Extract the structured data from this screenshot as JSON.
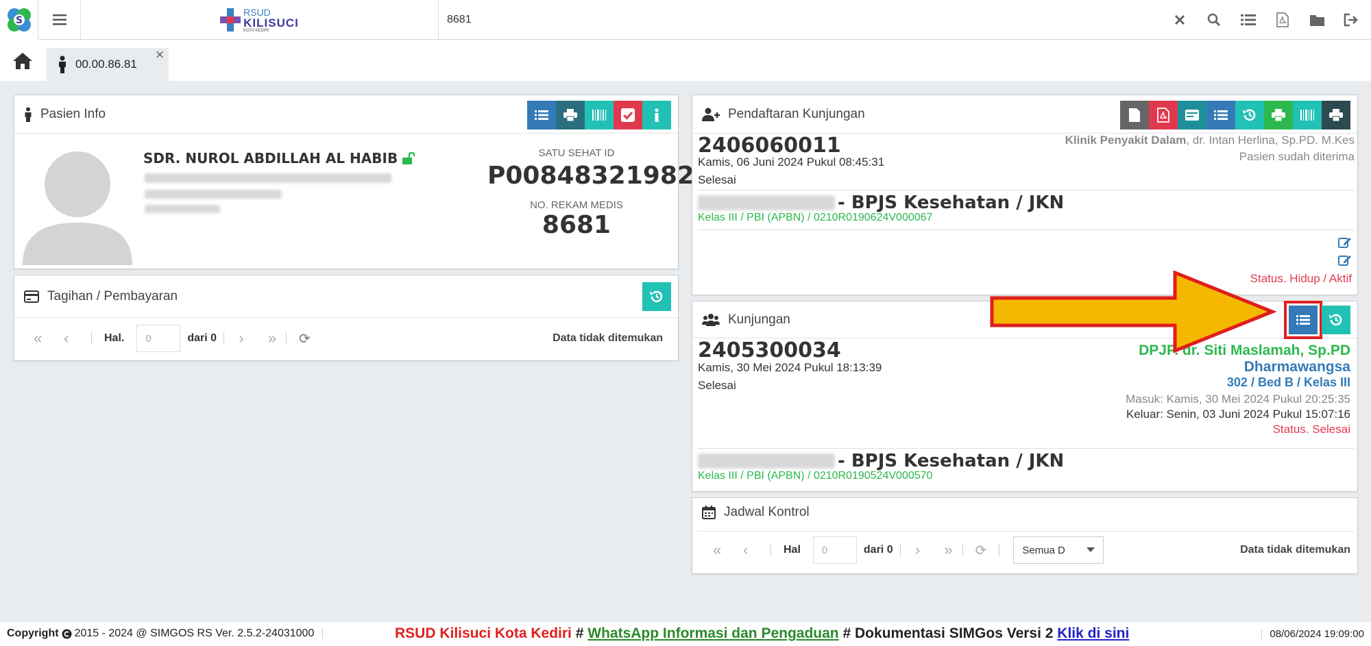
{
  "topbar": {
    "brand_line1": "RSUD",
    "brand_line2": "KILISUCI",
    "brand_line3": "KOTA KEDIRI",
    "search_value": "8681",
    "icons": [
      "close-icon",
      "search-icon",
      "list-icon",
      "pdf-file-icon",
      "folder-icon",
      "logout-icon"
    ]
  },
  "tabs": {
    "home_icon": "home-icon",
    "patient_tab": "00.00.86.81",
    "close": "×"
  },
  "pasien": {
    "title": "Pasien Info",
    "name": "SDR. NUROL ABDILLAH AL HABIB",
    "satu_sehat_label": "SATU SEHAT ID",
    "satu_sehat_id": "P00848321982",
    "rm_label": "NO. REKAM MEDIS",
    "rm_value": "8681"
  },
  "tagihan": {
    "title": "Tagihan / Pembayaran",
    "hal": "Hal.",
    "page_placeholder": "0",
    "dari": "dari 0",
    "empty": "Data tidak ditemukan"
  },
  "pendaftaran": {
    "title": "Pendaftaran Kunjungan",
    "number": "2406060011",
    "date": "Kamis, 06 Juni 2024 Pukul 08:45:31",
    "status": "Selesai",
    "clinic": "Klinik Penyakit Dalam",
    "doctor": ", dr. Intan Herlina, Sp.PD. M.Kes",
    "accepted": "Pasien sudah diterima",
    "insurance": "- BPJS Kesehatan / JKN",
    "kelas": "Kelas III / PBI (APBN) / 0210R0190624V000067",
    "life_status": "Status. Hidup / Aktif"
  },
  "kunjungan": {
    "title": "Kunjungan",
    "number": "2405300034",
    "date": "Kamis, 30 Mei 2024 Pukul 18:13:39",
    "status": "Selesai",
    "dpjp": "DPJP. dr. Siti Maslamah, Sp.PD",
    "ward": "Dharmawangsa",
    "bed": "302 / Bed B / Kelas III",
    "masuk": "Masuk: Kamis, 30 Mei 2024 Pukul 20:25:35",
    "keluar": "Keluar: Senin, 03 Juni 2024 Pukul 15:07:16",
    "visit_status": "Status. Selesai",
    "insurance": "- BPJS Kesehatan / JKN",
    "kelas": "Kelas III / PBI (APBN) / 0210R0190524V000570"
  },
  "jadwal": {
    "title": "Jadwal Kontrol",
    "hal": "Hal",
    "page_placeholder": "0",
    "dari": "dari 0",
    "select_value": "Semua D",
    "empty": "Data tidak ditemukan"
  },
  "footer": {
    "copyright": "Copyright",
    "copyright_rest": "2015 - 2024 @ SIMGOS RS Ver. 2.5.2-24031000",
    "marquee_part1": "RSUD Kilisuci Kota Kediri",
    "hash1": "#",
    "marquee_link1": "WhatsApp Informasi dan Pengaduan",
    "hash2": "#",
    "marquee_part2": "Dokumentasi SIMGos Versi 2",
    "marquee_link2": "Klik di sini",
    "datetime": "08/06/2024 19:09:00"
  },
  "colors": {
    "primary_blue": "#337ab7",
    "teal": "#22c1b5",
    "danger_red": "#e0394e",
    "success_green": "#2db84d",
    "highlight_arrow": "#f5b800"
  }
}
